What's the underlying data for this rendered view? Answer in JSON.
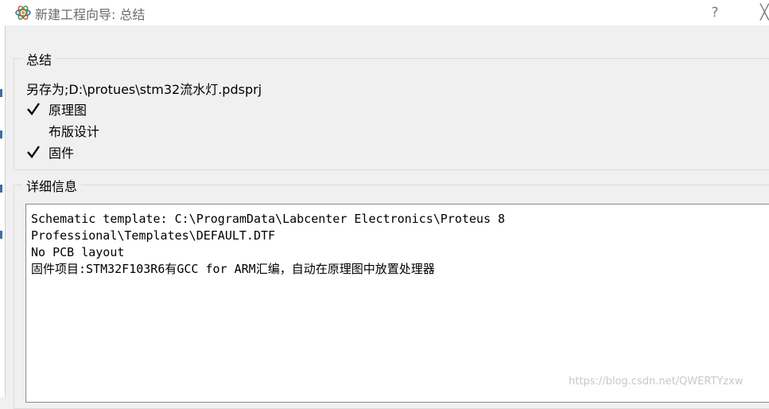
{
  "window": {
    "title": "新建工程向导: 总结",
    "help_label": "?",
    "close_label": "╳",
    "icon": "proteus-app-icon"
  },
  "summary": {
    "group_title": "总结",
    "save_as": "另存为;D:\\protues\\stm32流水灯.pdsprj",
    "items": [
      {
        "label": "原理图",
        "checked": true
      },
      {
        "label": "布版设计",
        "checked": false
      },
      {
        "label": "固件",
        "checked": true
      }
    ]
  },
  "details": {
    "group_title": "详细信息",
    "lines": [
      "Schematic template: C:\\ProgramData\\Labcenter Electronics\\Proteus 8",
      "Professional\\Templates\\DEFAULT.DTF",
      "No PCB layout",
      "固件项目:STM32F103R6有GCC for ARM汇编，自动在原理图中放置处理器"
    ]
  },
  "watermark": "https://blog.csdn.net/QWERTYzxw"
}
